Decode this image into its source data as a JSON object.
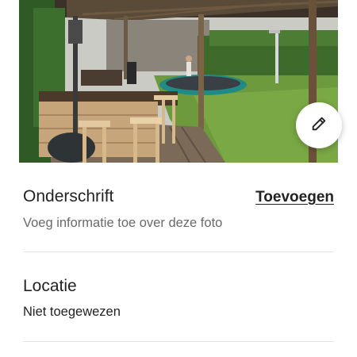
{
  "photo": {
    "alt_icon": "garden-photo"
  },
  "edit": {
    "icon": "pencil-icon"
  },
  "caption": {
    "title": "Onderschrift",
    "action": "Toevoegen",
    "hint": "Voeg informatie toe over deze foto"
  },
  "location": {
    "title": "Locatie",
    "value": "Niet toegewezen"
  },
  "colors": {
    "text": "#222222",
    "secondary": "#6a6a6a",
    "divider": "#e6e6e6"
  }
}
